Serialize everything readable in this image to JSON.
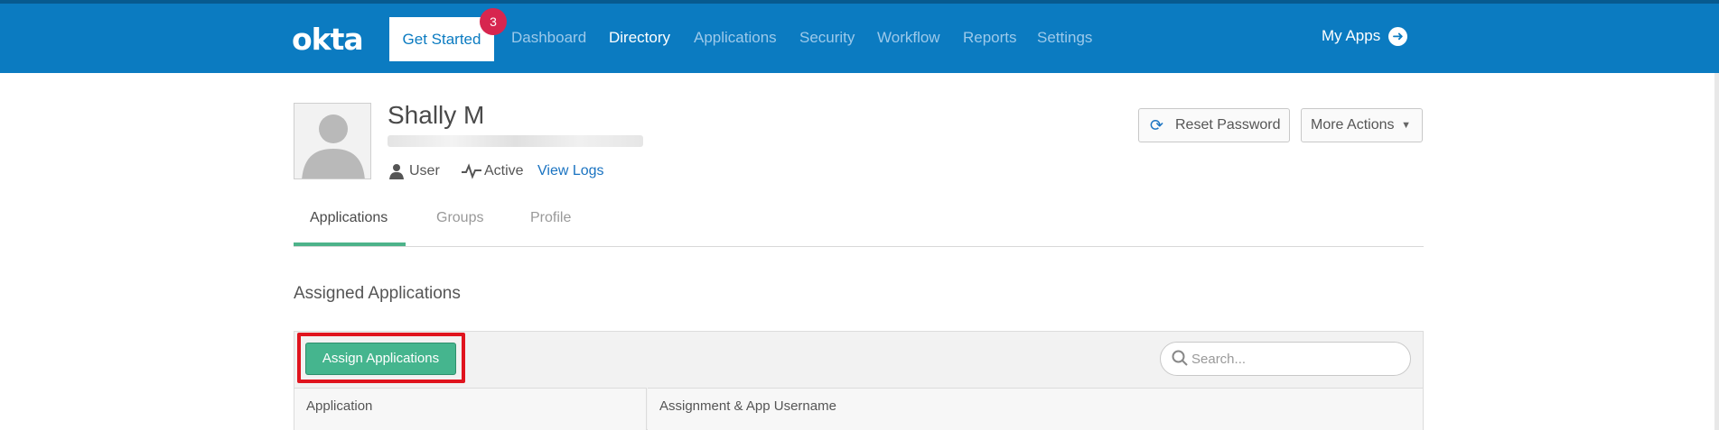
{
  "nav": {
    "logo": "okta",
    "get_started": "Get Started",
    "badge_count": "3",
    "items": [
      {
        "label": "Dashboard",
        "active": false
      },
      {
        "label": "Directory",
        "active": true
      },
      {
        "label": "Applications",
        "active": false
      },
      {
        "label": "Security",
        "active": false
      },
      {
        "label": "Workflow",
        "active": false
      },
      {
        "label": "Reports",
        "active": false
      },
      {
        "label": "Settings",
        "active": false
      }
    ],
    "my_apps": "My Apps",
    "my_apps_icon": "arrow-circle-right-icon"
  },
  "profile": {
    "name": "Shally M",
    "type": "User",
    "status": "Active",
    "view_logs": "View Logs",
    "reset_password": "Reset Password",
    "more_actions": "More Actions"
  },
  "tabs": [
    {
      "label": "Applications",
      "active": true
    },
    {
      "label": "Groups",
      "active": false
    },
    {
      "label": "Profile",
      "active": false
    }
  ],
  "assigned": {
    "title": "Assigned Applications",
    "assign_button": "Assign Applications",
    "search_placeholder": "Search...",
    "columns": [
      "Application",
      "Assignment & App Username"
    ]
  },
  "colors": {
    "brand": "#0b7bc1",
    "badge": "#d7264f",
    "success": "#45b58e",
    "highlight": "#e0141e"
  }
}
